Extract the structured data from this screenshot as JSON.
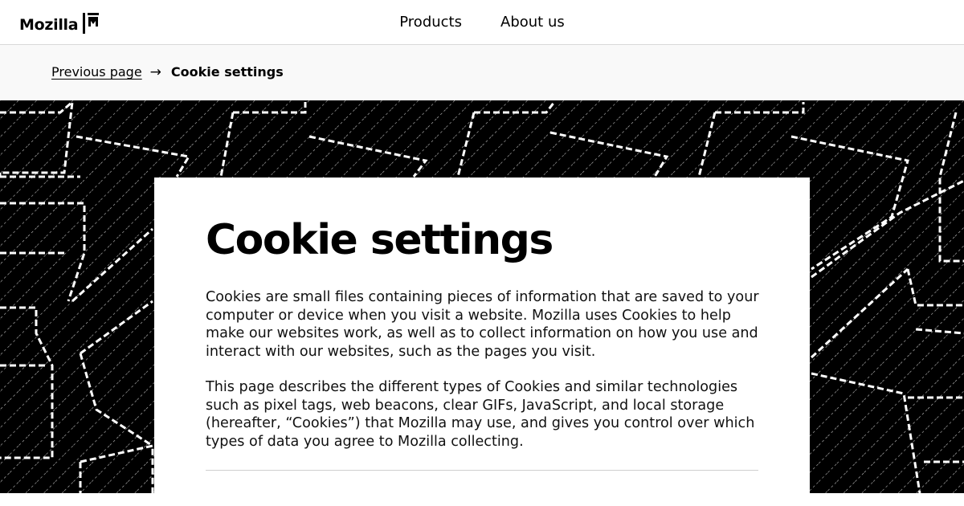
{
  "header": {
    "logo_text": "Mozilla",
    "logo_icon": "mozilla-m-bracket-icon",
    "nav": [
      {
        "label": "Products"
      },
      {
        "label": "About us"
      }
    ]
  },
  "breadcrumb": {
    "previous_label": "Previous page",
    "separator": "→",
    "current_label": "Cookie settings"
  },
  "main": {
    "title": "Cookie settings",
    "paragraphs": [
      "Cookies are small files containing pieces of information that are saved to your computer or device when you visit a website. Mozilla uses Cookies to help make our websites work, as well as to collect information on how you use and interact with our websites, such as the pages you visit.",
      "This page describes the different types of Cookies and similar technologies such as pixel tags, web beacons, clear GIFs, JavaScript, and local storage (hereafter, “Cookies”) that Mozilla may use, and gives you control over which types of data you agree to Mozilla collecting."
    ]
  },
  "colors": {
    "text": "#000000",
    "header_border": "#d8d8d8",
    "breadcrumb_bg": "#f9f9f9",
    "hero_bg": "#000000",
    "hero_pattern": "#ffffff",
    "card_bg": "#ffffff"
  }
}
